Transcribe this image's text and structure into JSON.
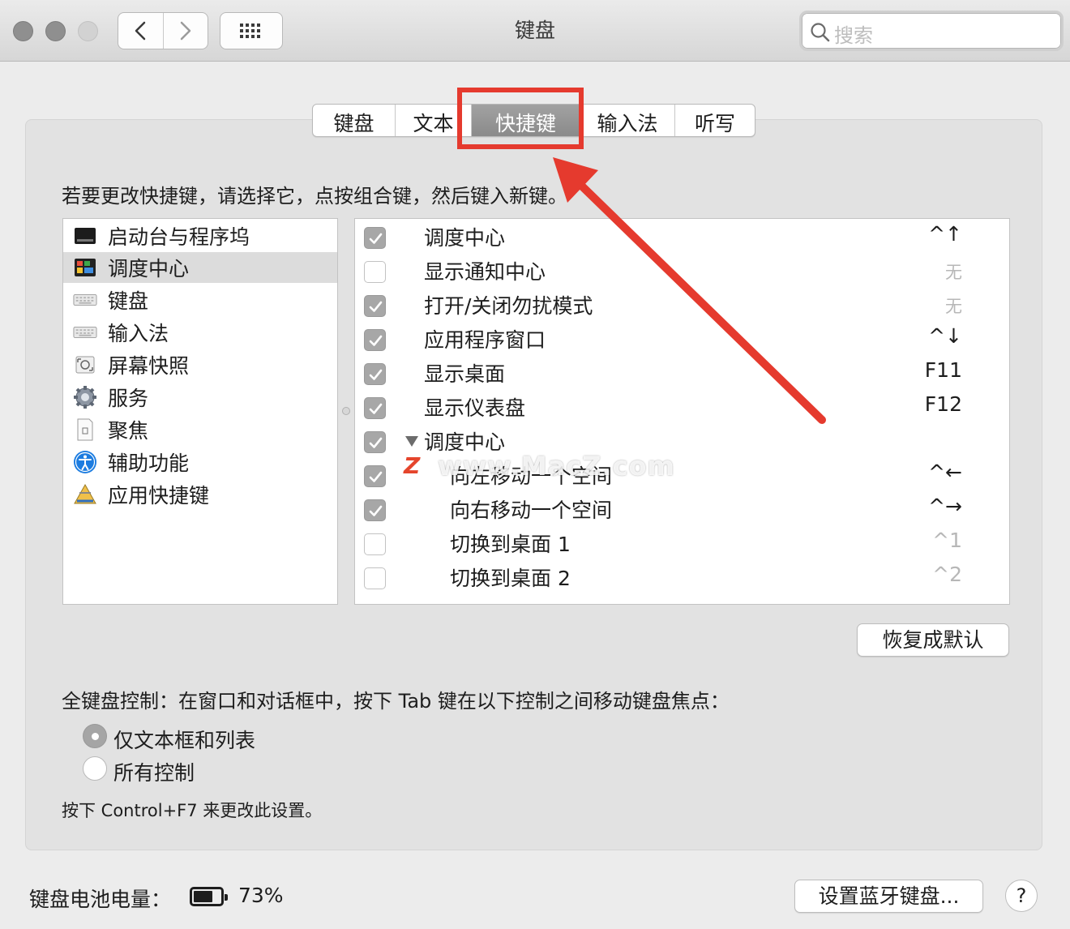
{
  "window": {
    "title": "键盘",
    "search_placeholder": "搜索"
  },
  "tabs": [
    {
      "label": "键盘",
      "active": false
    },
    {
      "label": "文本",
      "active": false
    },
    {
      "label": "快捷键",
      "active": true
    },
    {
      "label": "输入法",
      "active": false
    },
    {
      "label": "听写",
      "active": false
    }
  ],
  "instruction": "若要更改快捷键，请选择它，点按组合键，然后键入新键。",
  "categories": [
    {
      "label": "启动台与程序坞",
      "icon": "launchpad-icon",
      "selected": false
    },
    {
      "label": "调度中心",
      "icon": "mission-control-icon",
      "selected": true
    },
    {
      "label": "键盘",
      "icon": "keyboard-icon",
      "selected": false
    },
    {
      "label": "输入法",
      "icon": "input-method-icon",
      "selected": false
    },
    {
      "label": "屏幕快照",
      "icon": "screenshot-icon",
      "selected": false
    },
    {
      "label": "服务",
      "icon": "services-gear-icon",
      "selected": false
    },
    {
      "label": "聚焦",
      "icon": "spotlight-icon",
      "selected": false
    },
    {
      "label": "辅助功能",
      "icon": "accessibility-icon",
      "selected": false
    },
    {
      "label": "应用快捷键",
      "icon": "app-shortcuts-icon",
      "selected": false
    }
  ],
  "shortcuts": [
    {
      "label": "调度中心",
      "checked": true,
      "key": "^↑",
      "indent": 0
    },
    {
      "label": "显示通知中心",
      "checked": false,
      "key": "无",
      "indent": 0
    },
    {
      "label": "打开/关闭勿扰模式",
      "checked": true,
      "key": "无",
      "indent": 0
    },
    {
      "label": "应用程序窗口",
      "checked": true,
      "key": "^↓",
      "indent": 0
    },
    {
      "label": "显示桌面",
      "checked": true,
      "key": "F11",
      "indent": 0
    },
    {
      "label": "显示仪表盘",
      "checked": true,
      "key": "F12",
      "indent": 0
    },
    {
      "label": "调度中心",
      "checked": true,
      "key": "",
      "indent": 0,
      "group": true
    },
    {
      "label": "向左移动一个空间",
      "checked": true,
      "key": "^←",
      "indent": 1
    },
    {
      "label": "向右移动一个空间",
      "checked": true,
      "key": "^→",
      "indent": 1
    },
    {
      "label": "切换到桌面 1",
      "checked": false,
      "key": "^1",
      "indent": 1
    },
    {
      "label": "切换到桌面 2",
      "checked": false,
      "key": "^2",
      "indent": 1
    }
  ],
  "restore_button": "恢复成默认",
  "full_keyboard": {
    "description": "全键盘控制：在窗口和对话框中，按下 Tab 键在以下控制之间移动键盘焦点：",
    "options": [
      {
        "label": "仅文本框和列表",
        "selected": true
      },
      {
        "label": "所有控制",
        "selected": false
      }
    ],
    "hint": "按下 Control+F7 来更改此设置。"
  },
  "battery": {
    "label": "键盘电池电量：",
    "percent_text": "73%",
    "level": 0.73
  },
  "bluetooth_button": "设置蓝牙键盘...",
  "help_button": "?",
  "watermark": "www.MacZ.com",
  "colors": {
    "annotation_red": "#e53a2e"
  }
}
